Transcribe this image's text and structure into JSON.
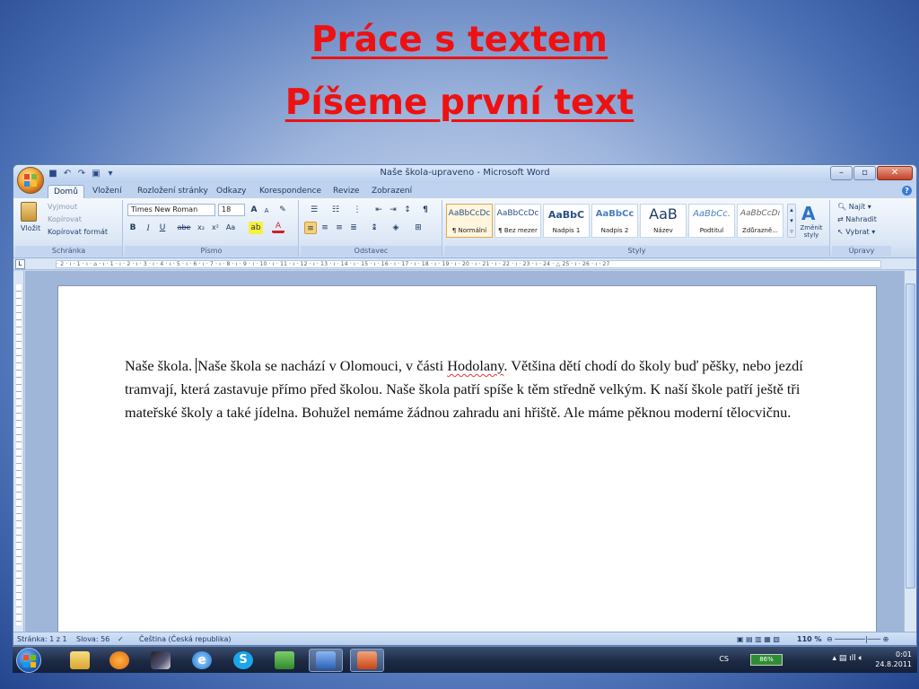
{
  "slide": {
    "title_line1": "Práce s textem",
    "title_line2": "Píšeme první text"
  },
  "window": {
    "title": "Naše škola-upraveno - Microsoft Word",
    "controls": [
      "–",
      "▫",
      "✕"
    ]
  },
  "tabs": [
    "Domů",
    "Vložení",
    "Rozložení stránky",
    "Odkazy",
    "Korespondence",
    "Revize",
    "Zobrazení"
  ],
  "ribbon": {
    "clipboard": {
      "paste": "Vložit",
      "cut": "Vyjmout",
      "copy": "Kopírovat",
      "format_painter": "Kopírovat formát",
      "label": "Schránka"
    },
    "font": {
      "name": "Times New Roman",
      "size": "18",
      "label": "Písmo",
      "bold": "B",
      "italic": "I",
      "underline": "U",
      "strike": "abe",
      "sub": "x₂",
      "sup": "x²",
      "case": "Aa",
      "grow": "A",
      "shrink": "A",
      "color": "A"
    },
    "paragraph": {
      "label": "Odstavec"
    },
    "styles": {
      "label": "Styly",
      "items": [
        {
          "preview": "AaBbCcDc",
          "name": "¶ Normální"
        },
        {
          "preview": "AaBbCcDc",
          "name": "¶ Bez mezer"
        },
        {
          "preview": "AaBbC",
          "name": "Nadpis 1"
        },
        {
          "preview": "AaBbCc",
          "name": "Nadpis 2"
        },
        {
          "preview": "AaB",
          "name": "Název"
        },
        {
          "preview": "AaBbCc.",
          "name": "Podtitul"
        },
        {
          "preview": "AaBbCcDı",
          "name": "Zdůrazně..."
        }
      ],
      "change_styles": "Změnit styly"
    },
    "editing": {
      "find": "Najít",
      "replace": "Nahradit",
      "select": "Vybrat",
      "label": "Úpravy"
    }
  },
  "ruler": {
    "text": "· 2 · ı · 1 · ı · ⌂ · ı · 1 · ı · 2 · ı · 3 · ı · 4 · ı · 5 · ı · 6 · ı · 7 · ı · 8 · ı · 9 · ı · 10 · ı · 11 · ı · 12 · ı · 13 · ı · 14 · ı · 15 · ı · 16 · ı · 17 · ı · 18 · ı · 19 · ı · 20 · ı · 21 · ı · 22 · ı · 23 · ı · 24 · △ 25 · ı · 26 · ı · 27"
  },
  "document": {
    "text_before_caret": "Naše škola. ",
    "text_mid": "Naše škola se nachází v Olomouci, v části ",
    "misspelled": "Hodolany",
    "text_after": ". Většina dětí chodí do školy buď pěšky, nebo jezdí tramvají, která zastavuje přímo před školou. Naše škola patří spíše k těm středně velkým. K naší škole patří ještě tři mateřské školy a také jídelna. Bohužel nemáme žádnou zahradu ani hřiště. Ale máme pěknou moderní tělocvičnu."
  },
  "statusbar": {
    "page": "Stránka: 1 z 1",
    "words": "Slova: 56",
    "language": "Čeština (Česká republika)",
    "zoom": "110 %"
  },
  "taskbar": {
    "lang": "CS",
    "battery": "86%",
    "time": "0:01",
    "date": "24.8.2011"
  },
  "colors": {
    "title_red": "#ee1111",
    "ribbon_blue": "#dde8f6",
    "taskbar": "#1d2a44"
  }
}
